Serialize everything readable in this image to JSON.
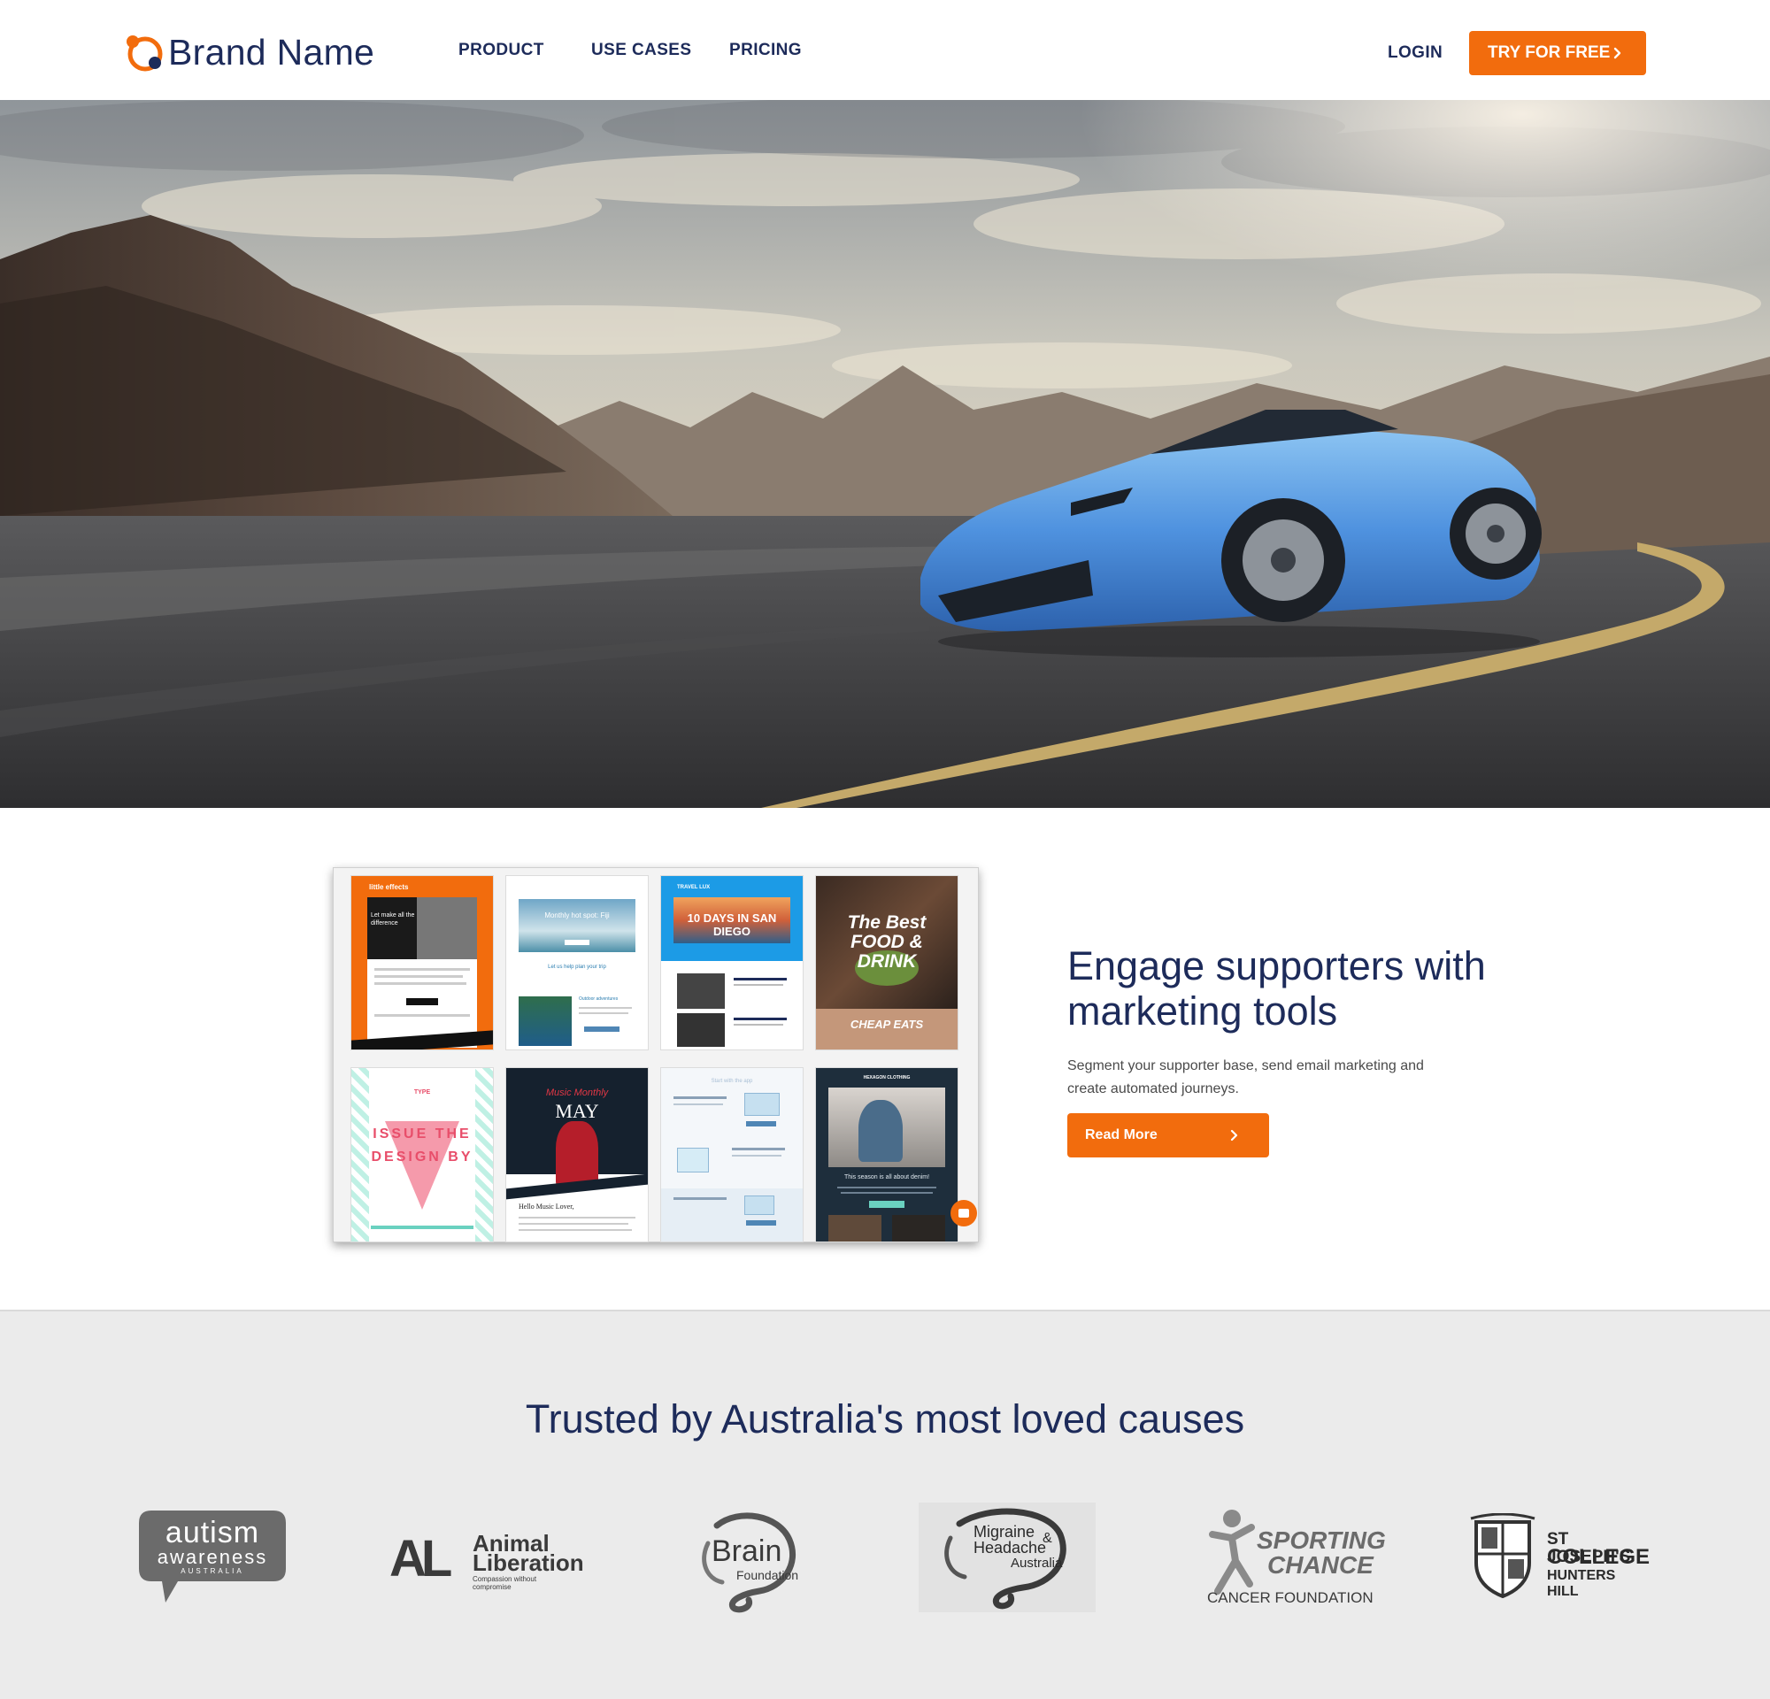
{
  "header": {
    "brand_name": "Brand Name",
    "nav": [
      "PRODUCT",
      "USE CASES",
      "PRICING"
    ],
    "login_label": "LOGIN",
    "cta_label": "TRY FOR FREE"
  },
  "feature": {
    "title": "Engage supporters with marketing tools",
    "body": "Segment your supporter base, send email marketing and create automated journeys.",
    "button_label": "Read More",
    "templates": [
      {
        "name": "little-effects",
        "title": "Let make all the difference",
        "brand": "little effects"
      },
      {
        "name": "travel-fiji",
        "title": "Monthly hot spot: Fiji",
        "subtitle": "Let us help plan your trip",
        "section": "Outdoor adventures"
      },
      {
        "name": "travel-san-diego",
        "brand": "TRAVEL LUX",
        "title": "10 DAYS IN SAN DIEGO"
      },
      {
        "name": "food-drink",
        "title": "The Best FOOD & DRINK",
        "subtitle": "CHEAP EATS"
      },
      {
        "name": "issue-design",
        "title": "ISSUE THE DESIGN BY",
        "brand": "TYPE"
      },
      {
        "name": "music-monthly",
        "title": "Music Monthly",
        "subtitle": "MAY",
        "greeting": "Hello Music Lover,"
      },
      {
        "name": "app-update",
        "title": "Start with the app"
      },
      {
        "name": "hexagon-clothing",
        "brand": "HEXAGON CLOTHING",
        "title": "This season is all about denim!"
      }
    ]
  },
  "trusted": {
    "title": "Trusted by Australia's most loved causes",
    "logos": [
      {
        "name": "autism-awareness",
        "line1": "autism",
        "line2": "awareness",
        "line3": "AUSTRALIA"
      },
      {
        "name": "animal-liberation",
        "mark": "AL",
        "line1": "Animal",
        "line2": "Liberation",
        "line3": "Compassion without compromise"
      },
      {
        "name": "brain-foundation",
        "line1": "Brain",
        "line2": "Foundation"
      },
      {
        "name": "migraine-headache",
        "line1": "Migraine",
        "line2": "Headache",
        "line3": "Australia",
        "amp": "&"
      },
      {
        "name": "sporting-chance",
        "line1": "SPORTING",
        "line2": "CHANCE",
        "line3": "CANCER FOUNDATION"
      },
      {
        "name": "st-josephs",
        "line1": "ST JOSEPH'S",
        "line2": "COLLEGE",
        "line3": "HUNTERS HILL"
      }
    ]
  }
}
